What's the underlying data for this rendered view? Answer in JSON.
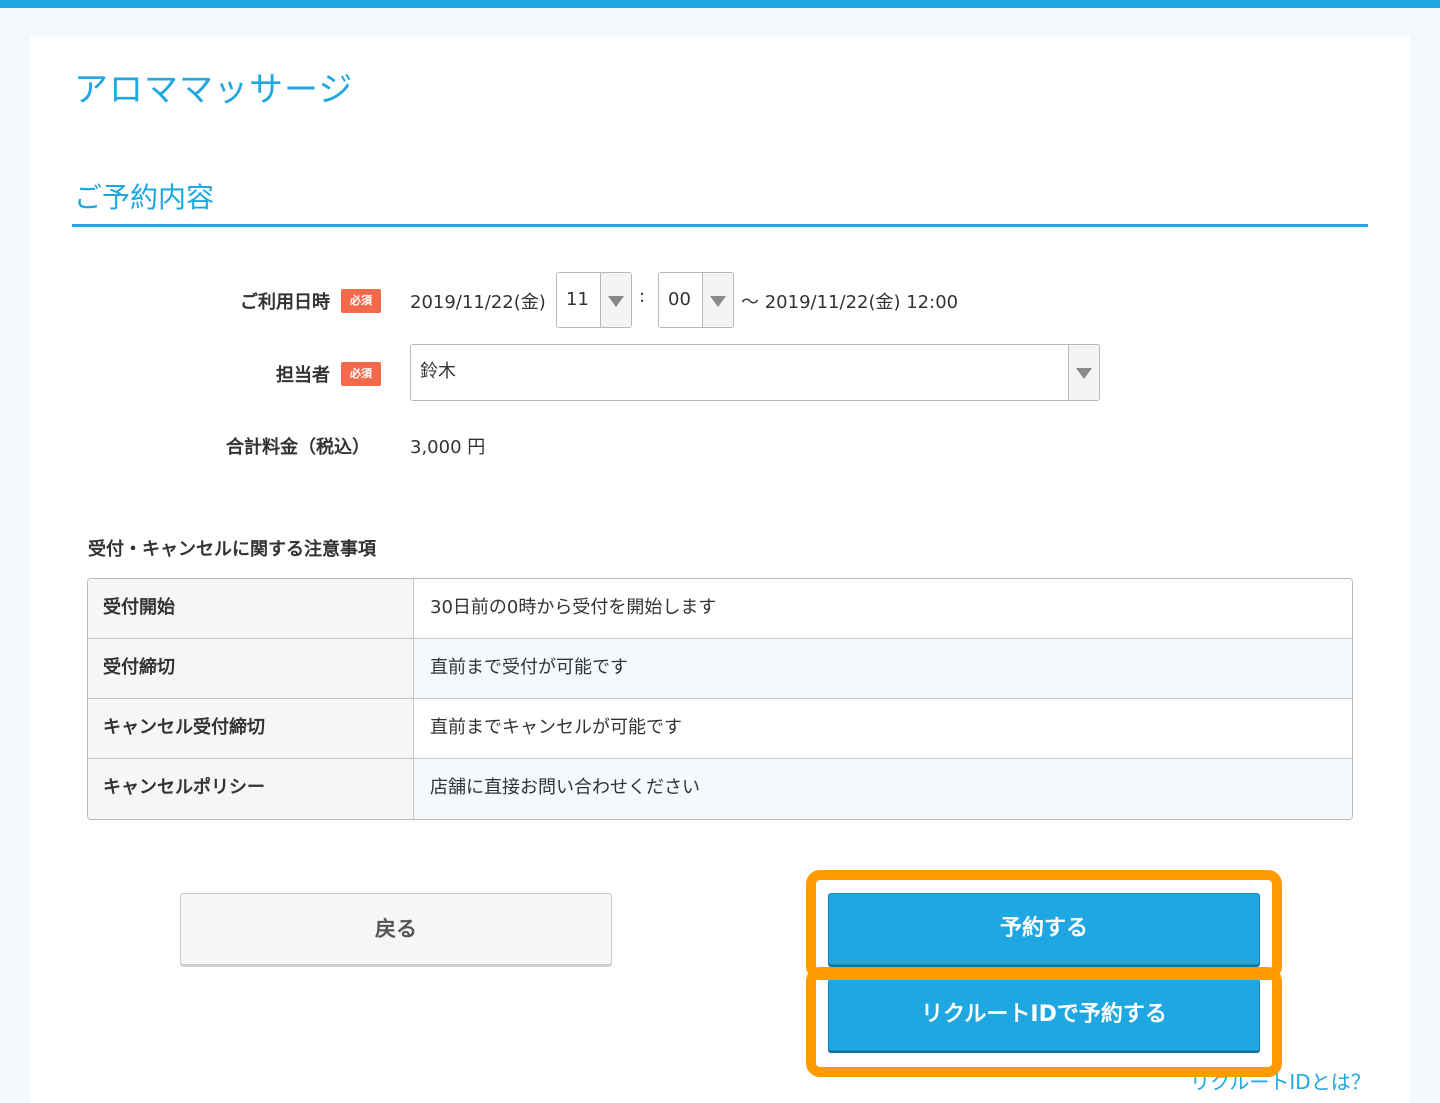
{
  "page": {
    "title": "アロママッサージ"
  },
  "section": {
    "title": "ご予約内容"
  },
  "form": {
    "datetime": {
      "label": "ご利用日時",
      "required_badge": "必須",
      "start_date": "2019/11/22(金)",
      "hour_select": "11",
      "colon": ":",
      "minute_select": "00",
      "end_text": "〜 2019/11/22(金) 12:00"
    },
    "staff": {
      "label": "担当者",
      "required_badge": "必須",
      "select_value": "鈴木"
    },
    "total": {
      "label": "合計料金（税込）",
      "value": "3,000 円"
    }
  },
  "notes": {
    "heading": "受付・キャンセルに関する注意事項",
    "rows": [
      {
        "key": "受付開始",
        "value": "30日前の0時から受付を開始します"
      },
      {
        "key": "受付締切",
        "value": "直前まで受付が可能です"
      },
      {
        "key": "キャンセル受付締切",
        "value": "直前までキャンセルが可能です"
      },
      {
        "key": "キャンセルポリシー",
        "value": "店舗に直接お問い合わせください"
      }
    ]
  },
  "actions": {
    "back_label": "戻る",
    "reserve_label": "予約する",
    "reserve_recruit_label": "リクルートIDで予約する",
    "recruit_help_link": "リクルートIDとは？"
  },
  "colors": {
    "accent": "#1ea7e0",
    "required_badge": "#f06a4b",
    "highlight": "#ff9a00"
  }
}
